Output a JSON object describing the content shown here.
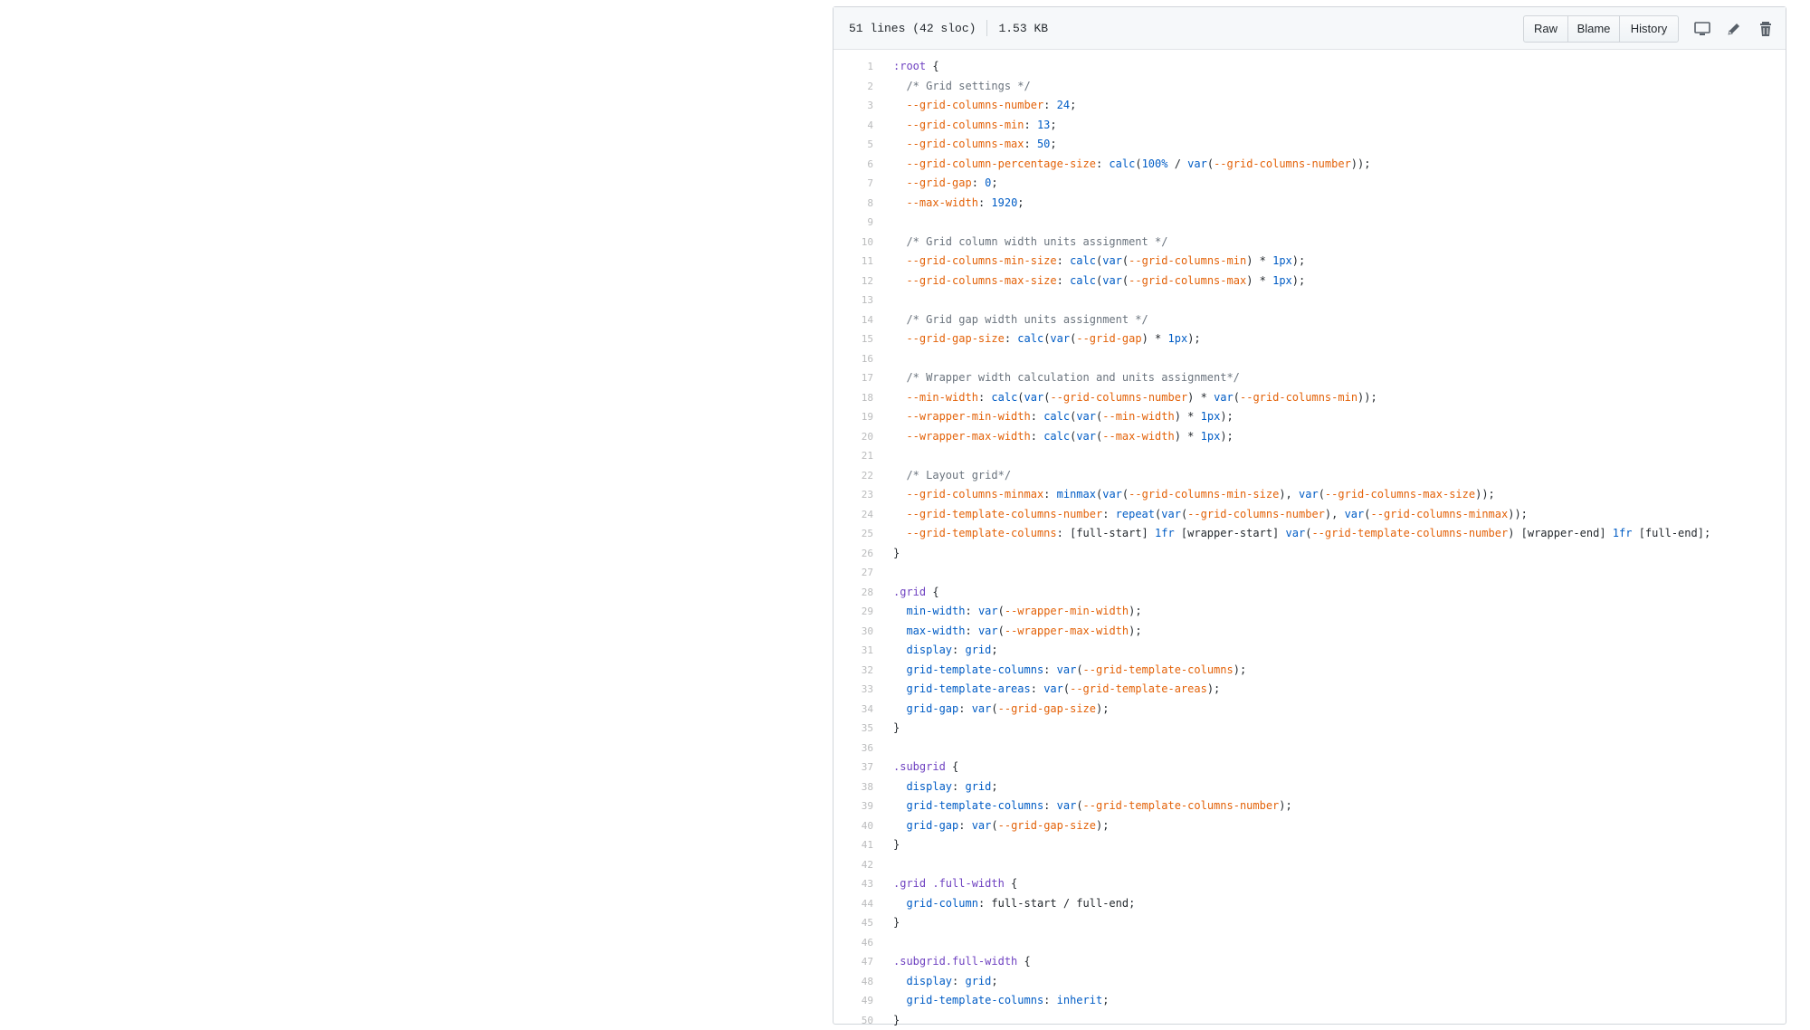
{
  "file_header": {
    "lines_info": "51 lines (42 sloc)",
    "size_info": "1.53 KB",
    "buttons": {
      "raw": "Raw",
      "blame": "Blame",
      "history": "History"
    }
  },
  "icons": {
    "desktop": "desktop-icon",
    "edit": "pencil-icon",
    "delete": "trash-icon"
  },
  "colors": {
    "selector": "#6f42c1",
    "property": "#e36209",
    "value": "#005cc5",
    "comment": "#6a737d",
    "line_number": "#babbbc"
  },
  "code_lines": [
    {
      "n": "1",
      "tokens": [
        [
          "t-sel",
          ":root"
        ],
        [
          "t-pl",
          " {"
        ]
      ]
    },
    {
      "n": "2",
      "tokens": [
        [
          "t-com",
          "  /* Grid settings */"
        ]
      ]
    },
    {
      "n": "3",
      "tokens": [
        [
          "t-pl",
          "  "
        ],
        [
          "t-prop",
          "--grid-columns-number"
        ],
        [
          "t-pl",
          ": "
        ],
        [
          "t-num",
          "24"
        ],
        [
          "t-pl",
          ";"
        ]
      ]
    },
    {
      "n": "4",
      "tokens": [
        [
          "t-pl",
          "  "
        ],
        [
          "t-prop",
          "--grid-columns-min"
        ],
        [
          "t-pl",
          ": "
        ],
        [
          "t-num",
          "13"
        ],
        [
          "t-pl",
          ";"
        ]
      ]
    },
    {
      "n": "5",
      "tokens": [
        [
          "t-pl",
          "  "
        ],
        [
          "t-prop",
          "--grid-columns-max"
        ],
        [
          "t-pl",
          ": "
        ],
        [
          "t-num",
          "50"
        ],
        [
          "t-pl",
          ";"
        ]
      ]
    },
    {
      "n": "6",
      "tokens": [
        [
          "t-pl",
          "  "
        ],
        [
          "t-prop",
          "--grid-column-percentage-size"
        ],
        [
          "t-pl",
          ": "
        ],
        [
          "t-fn",
          "calc"
        ],
        [
          "t-pl",
          "("
        ],
        [
          "t-num",
          "100%"
        ],
        [
          "t-pl",
          " / "
        ],
        [
          "t-fn",
          "var"
        ],
        [
          "t-pl",
          "("
        ],
        [
          "t-prop",
          "--grid-columns-number"
        ],
        [
          "t-pl",
          "));"
        ]
      ]
    },
    {
      "n": "7",
      "tokens": [
        [
          "t-pl",
          "  "
        ],
        [
          "t-prop",
          "--grid-gap"
        ],
        [
          "t-pl",
          ": "
        ],
        [
          "t-num",
          "0"
        ],
        [
          "t-pl",
          ";"
        ]
      ]
    },
    {
      "n": "8",
      "tokens": [
        [
          "t-pl",
          "  "
        ],
        [
          "t-prop",
          "--max-width"
        ],
        [
          "t-pl",
          ": "
        ],
        [
          "t-num",
          "1920"
        ],
        [
          "t-pl",
          ";"
        ]
      ]
    },
    {
      "n": "9",
      "tokens": []
    },
    {
      "n": "10",
      "tokens": [
        [
          "t-com",
          "  /* Grid column width units assignment */"
        ]
      ]
    },
    {
      "n": "11",
      "tokens": [
        [
          "t-pl",
          "  "
        ],
        [
          "t-prop",
          "--grid-columns-min-size"
        ],
        [
          "t-pl",
          ": "
        ],
        [
          "t-fn",
          "calc"
        ],
        [
          "t-pl",
          "("
        ],
        [
          "t-fn",
          "var"
        ],
        [
          "t-pl",
          "("
        ],
        [
          "t-prop",
          "--grid-columns-min"
        ],
        [
          "t-pl",
          ") * "
        ],
        [
          "t-num",
          "1px"
        ],
        [
          "t-pl",
          ");"
        ]
      ]
    },
    {
      "n": "12",
      "tokens": [
        [
          "t-pl",
          "  "
        ],
        [
          "t-prop",
          "--grid-columns-max-size"
        ],
        [
          "t-pl",
          ": "
        ],
        [
          "t-fn",
          "calc"
        ],
        [
          "t-pl",
          "("
        ],
        [
          "t-fn",
          "var"
        ],
        [
          "t-pl",
          "("
        ],
        [
          "t-prop",
          "--grid-columns-max"
        ],
        [
          "t-pl",
          ") * "
        ],
        [
          "t-num",
          "1px"
        ],
        [
          "t-pl",
          ");"
        ]
      ]
    },
    {
      "n": "13",
      "tokens": []
    },
    {
      "n": "14",
      "tokens": [
        [
          "t-com",
          "  /* Grid gap width units assignment */"
        ]
      ]
    },
    {
      "n": "15",
      "tokens": [
        [
          "t-pl",
          "  "
        ],
        [
          "t-prop",
          "--grid-gap-size"
        ],
        [
          "t-pl",
          ": "
        ],
        [
          "t-fn",
          "calc"
        ],
        [
          "t-pl",
          "("
        ],
        [
          "t-fn",
          "var"
        ],
        [
          "t-pl",
          "("
        ],
        [
          "t-prop",
          "--grid-gap"
        ],
        [
          "t-pl",
          ") * "
        ],
        [
          "t-num",
          "1px"
        ],
        [
          "t-pl",
          ");"
        ]
      ]
    },
    {
      "n": "16",
      "tokens": []
    },
    {
      "n": "17",
      "tokens": [
        [
          "t-com",
          "  /* Wrapper width calculation and units assignment*/"
        ]
      ]
    },
    {
      "n": "18",
      "tokens": [
        [
          "t-pl",
          "  "
        ],
        [
          "t-prop",
          "--min-width"
        ],
        [
          "t-pl",
          ": "
        ],
        [
          "t-fn",
          "calc"
        ],
        [
          "t-pl",
          "("
        ],
        [
          "t-fn",
          "var"
        ],
        [
          "t-pl",
          "("
        ],
        [
          "t-prop",
          "--grid-columns-number"
        ],
        [
          "t-pl",
          ") * "
        ],
        [
          "t-fn",
          "var"
        ],
        [
          "t-pl",
          "("
        ],
        [
          "t-prop",
          "--grid-columns-min"
        ],
        [
          "t-pl",
          "));"
        ]
      ]
    },
    {
      "n": "19",
      "tokens": [
        [
          "t-pl",
          "  "
        ],
        [
          "t-prop",
          "--wrapper-min-width"
        ],
        [
          "t-pl",
          ": "
        ],
        [
          "t-fn",
          "calc"
        ],
        [
          "t-pl",
          "("
        ],
        [
          "t-fn",
          "var"
        ],
        [
          "t-pl",
          "("
        ],
        [
          "t-prop",
          "--min-width"
        ],
        [
          "t-pl",
          ") * "
        ],
        [
          "t-num",
          "1px"
        ],
        [
          "t-pl",
          ");"
        ]
      ]
    },
    {
      "n": "20",
      "tokens": [
        [
          "t-pl",
          "  "
        ],
        [
          "t-prop",
          "--wrapper-max-width"
        ],
        [
          "t-pl",
          ": "
        ],
        [
          "t-fn",
          "calc"
        ],
        [
          "t-pl",
          "("
        ],
        [
          "t-fn",
          "var"
        ],
        [
          "t-pl",
          "("
        ],
        [
          "t-prop",
          "--max-width"
        ],
        [
          "t-pl",
          ") * "
        ],
        [
          "t-num",
          "1px"
        ],
        [
          "t-pl",
          ");"
        ]
      ]
    },
    {
      "n": "21",
      "tokens": []
    },
    {
      "n": "22",
      "tokens": [
        [
          "t-com",
          "  /* Layout grid*/"
        ]
      ]
    },
    {
      "n": "23",
      "tokens": [
        [
          "t-pl",
          "  "
        ],
        [
          "t-prop",
          "--grid-columns-minmax"
        ],
        [
          "t-pl",
          ": "
        ],
        [
          "t-fn",
          "minmax"
        ],
        [
          "t-pl",
          "("
        ],
        [
          "t-fn",
          "var"
        ],
        [
          "t-pl",
          "("
        ],
        [
          "t-prop",
          "--grid-columns-min-size"
        ],
        [
          "t-pl",
          "), "
        ],
        [
          "t-fn",
          "var"
        ],
        [
          "t-pl",
          "("
        ],
        [
          "t-prop",
          "--grid-columns-max-size"
        ],
        [
          "t-pl",
          "));"
        ]
      ]
    },
    {
      "n": "24",
      "tokens": [
        [
          "t-pl",
          "  "
        ],
        [
          "t-prop",
          "--grid-template-columns-number"
        ],
        [
          "t-pl",
          ": "
        ],
        [
          "t-fn",
          "repeat"
        ],
        [
          "t-pl",
          "("
        ],
        [
          "t-fn",
          "var"
        ],
        [
          "t-pl",
          "("
        ],
        [
          "t-prop",
          "--grid-columns-number"
        ],
        [
          "t-pl",
          "), "
        ],
        [
          "t-fn",
          "var"
        ],
        [
          "t-pl",
          "("
        ],
        [
          "t-prop",
          "--grid-columns-minmax"
        ],
        [
          "t-pl",
          "));"
        ]
      ]
    },
    {
      "n": "25",
      "tokens": [
        [
          "t-pl",
          "  "
        ],
        [
          "t-prop",
          "--grid-template-columns"
        ],
        [
          "t-pl",
          ": [full-start] "
        ],
        [
          "t-num",
          "1fr"
        ],
        [
          "t-pl",
          " [wrapper-start] "
        ],
        [
          "t-fn",
          "var"
        ],
        [
          "t-pl",
          "("
        ],
        [
          "t-prop",
          "--grid-template-columns-number"
        ],
        [
          "t-pl",
          ") [wrapper-end] "
        ],
        [
          "t-num",
          "1fr"
        ],
        [
          "t-pl",
          " [full-end];"
        ]
      ]
    },
    {
      "n": "26",
      "tokens": [
        [
          "t-pl",
          "}"
        ]
      ]
    },
    {
      "n": "27",
      "tokens": []
    },
    {
      "n": "28",
      "tokens": [
        [
          "t-sel",
          ".grid"
        ],
        [
          "t-pl",
          " {"
        ]
      ]
    },
    {
      "n": "29",
      "tokens": [
        [
          "t-pl",
          "  "
        ],
        [
          "t-num",
          "min-width"
        ],
        [
          "t-pl",
          ": "
        ],
        [
          "t-fn",
          "var"
        ],
        [
          "t-pl",
          "("
        ],
        [
          "t-prop",
          "--wrapper-min-width"
        ],
        [
          "t-pl",
          ");"
        ]
      ]
    },
    {
      "n": "30",
      "tokens": [
        [
          "t-pl",
          "  "
        ],
        [
          "t-num",
          "max-width"
        ],
        [
          "t-pl",
          ": "
        ],
        [
          "t-fn",
          "var"
        ],
        [
          "t-pl",
          "("
        ],
        [
          "t-prop",
          "--wrapper-max-width"
        ],
        [
          "t-pl",
          ");"
        ]
      ]
    },
    {
      "n": "31",
      "tokens": [
        [
          "t-pl",
          "  "
        ],
        [
          "t-num",
          "display"
        ],
        [
          "t-pl",
          ": "
        ],
        [
          "t-num",
          "grid"
        ],
        [
          "t-pl",
          ";"
        ]
      ]
    },
    {
      "n": "32",
      "tokens": [
        [
          "t-pl",
          "  "
        ],
        [
          "t-num",
          "grid-template-columns"
        ],
        [
          "t-pl",
          ": "
        ],
        [
          "t-fn",
          "var"
        ],
        [
          "t-pl",
          "("
        ],
        [
          "t-prop",
          "--grid-template-columns"
        ],
        [
          "t-pl",
          ");"
        ]
      ]
    },
    {
      "n": "33",
      "tokens": [
        [
          "t-pl",
          "  "
        ],
        [
          "t-num",
          "grid-template-areas"
        ],
        [
          "t-pl",
          ": "
        ],
        [
          "t-fn",
          "var"
        ],
        [
          "t-pl",
          "("
        ],
        [
          "t-prop",
          "--grid-template-areas"
        ],
        [
          "t-pl",
          ");"
        ]
      ]
    },
    {
      "n": "34",
      "tokens": [
        [
          "t-pl",
          "  "
        ],
        [
          "t-num",
          "grid-gap"
        ],
        [
          "t-pl",
          ": "
        ],
        [
          "t-fn",
          "var"
        ],
        [
          "t-pl",
          "("
        ],
        [
          "t-prop",
          "--grid-gap-size"
        ],
        [
          "t-pl",
          ");"
        ]
      ]
    },
    {
      "n": "35",
      "tokens": [
        [
          "t-pl",
          "}"
        ]
      ]
    },
    {
      "n": "36",
      "tokens": []
    },
    {
      "n": "37",
      "tokens": [
        [
          "t-sel",
          ".subgrid"
        ],
        [
          "t-pl",
          " {"
        ]
      ]
    },
    {
      "n": "38",
      "tokens": [
        [
          "t-pl",
          "  "
        ],
        [
          "t-num",
          "display"
        ],
        [
          "t-pl",
          ": "
        ],
        [
          "t-num",
          "grid"
        ],
        [
          "t-pl",
          ";"
        ]
      ]
    },
    {
      "n": "39",
      "tokens": [
        [
          "t-pl",
          "  "
        ],
        [
          "t-num",
          "grid-template-columns"
        ],
        [
          "t-pl",
          ": "
        ],
        [
          "t-fn",
          "var"
        ],
        [
          "t-pl",
          "("
        ],
        [
          "t-prop",
          "--grid-template-columns-number"
        ],
        [
          "t-pl",
          ");"
        ]
      ]
    },
    {
      "n": "40",
      "tokens": [
        [
          "t-pl",
          "  "
        ],
        [
          "t-num",
          "grid-gap"
        ],
        [
          "t-pl",
          ": "
        ],
        [
          "t-fn",
          "var"
        ],
        [
          "t-pl",
          "("
        ],
        [
          "t-prop",
          "--grid-gap-size"
        ],
        [
          "t-pl",
          ");"
        ]
      ]
    },
    {
      "n": "41",
      "tokens": [
        [
          "t-pl",
          "}"
        ]
      ]
    },
    {
      "n": "42",
      "tokens": []
    },
    {
      "n": "43",
      "tokens": [
        [
          "t-sel",
          ".grid .full-width"
        ],
        [
          "t-pl",
          " {"
        ]
      ]
    },
    {
      "n": "44",
      "tokens": [
        [
          "t-pl",
          "  "
        ],
        [
          "t-num",
          "grid-column"
        ],
        [
          "t-pl",
          ": full-start / full-end;"
        ]
      ]
    },
    {
      "n": "45",
      "tokens": [
        [
          "t-pl",
          "}"
        ]
      ]
    },
    {
      "n": "46",
      "tokens": []
    },
    {
      "n": "47",
      "tokens": [
        [
          "t-sel",
          ".subgrid.full-width"
        ],
        [
          "t-pl",
          " {"
        ]
      ]
    },
    {
      "n": "48",
      "tokens": [
        [
          "t-pl",
          "  "
        ],
        [
          "t-num",
          "display"
        ],
        [
          "t-pl",
          ": "
        ],
        [
          "t-num",
          "grid"
        ],
        [
          "t-pl",
          ";"
        ]
      ]
    },
    {
      "n": "49",
      "tokens": [
        [
          "t-pl",
          "  "
        ],
        [
          "t-num",
          "grid-template-columns"
        ],
        [
          "t-pl",
          ": "
        ],
        [
          "t-num",
          "inherit"
        ],
        [
          "t-pl",
          ";"
        ]
      ]
    },
    {
      "n": "50",
      "tokens": [
        [
          "t-pl",
          "}"
        ]
      ]
    }
  ]
}
